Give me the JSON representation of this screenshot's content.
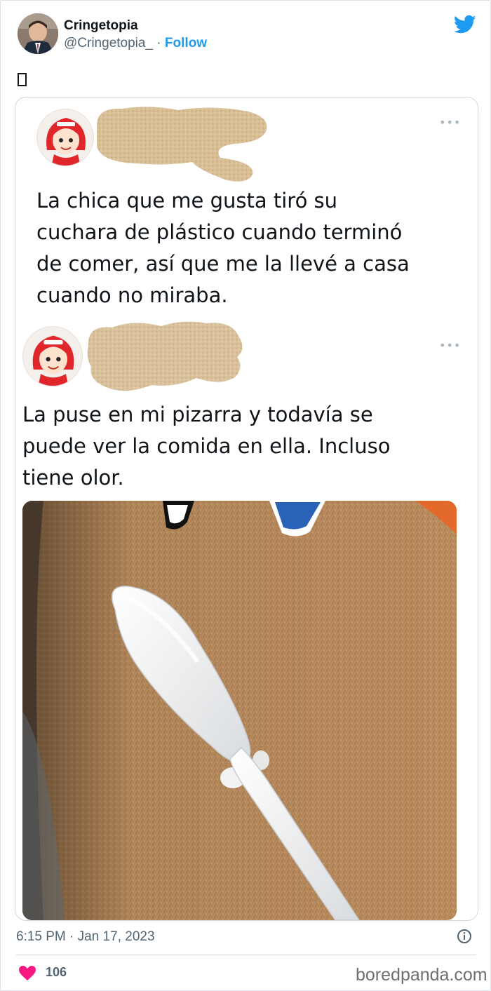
{
  "author": {
    "display_name": "Cringetopia",
    "handle": "@Cringetopia_",
    "separator": " · ",
    "follow_label": "Follow"
  },
  "tweet_text": "",
  "quoted": {
    "tweet_1_lines": [
      "La chica que me gusta tiró su",
      "cuchara de plástico cuando terminó",
      "de comer, así que me la llevé a casa",
      "cuando no miraba."
    ],
    "tweet_2_lines": [
      "La puse en mi pizarra y todavía se",
      "puede ver la comida en ella. Incluso",
      "tiene olor."
    ],
    "tweet_2_handle_fragment": "@"
  },
  "footer": {
    "timestamp": "6:15 PM · Jan 17, 2023",
    "likes": "106",
    "watermark": "boredpanda.com"
  },
  "colors": {
    "twitter_blue": "#1d9bf0",
    "like_pink": "#f91880",
    "muted_text": "#536471"
  },
  "icons": [
    "twitter-bird-icon",
    "more-icon",
    "info-icon",
    "heart-icon"
  ]
}
